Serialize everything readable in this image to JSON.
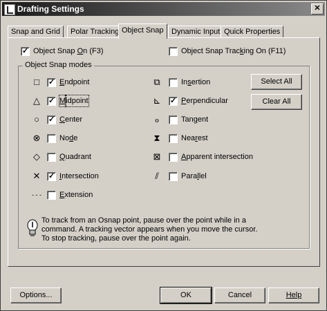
{
  "window": {
    "title": "Drafting Settings",
    "close_glyph": "✕"
  },
  "tabs": [
    {
      "label": "Snap and Grid"
    },
    {
      "label": "Polar Tracking"
    },
    {
      "label": "Object Snap",
      "active": true
    },
    {
      "label": "Dynamic Input"
    },
    {
      "label": "Quick Properties"
    }
  ],
  "top_options": {
    "snap_on": {
      "label_pre": "Object Snap ",
      "label_u": "O",
      "label_post": "n (F3)",
      "checked": true
    },
    "tracking_on": {
      "label_pre": "Object Snap Trac",
      "label_u": "k",
      "label_post": "ing On (F11)",
      "checked": false
    }
  },
  "group": {
    "legend": "Object Snap modes"
  },
  "modes_left": [
    {
      "name": "Endpoint",
      "u": "E",
      "rest": "ndpoint",
      "checked": true,
      "icon": "□"
    },
    {
      "name": "Midpoint",
      "u": "M",
      "rest": "idpoint",
      "checked": true,
      "icon": "△"
    },
    {
      "name": "Center",
      "u": "C",
      "rest": "enter",
      "checked": true,
      "icon": "○"
    },
    {
      "name": "Node",
      "pre": "No",
      "u": "d",
      "rest": "e",
      "checked": false,
      "icon": "⊗"
    },
    {
      "name": "Quadrant",
      "u": "Q",
      "rest": "uadrant",
      "checked": false,
      "icon": "◇"
    },
    {
      "name": "Intersection",
      "u": "I",
      "rest": "ntersection",
      "checked": true,
      "icon": "✕"
    },
    {
      "name": "Extension",
      "u": "E",
      "rest": "xtension",
      "checked": false,
      "icon": "- - -"
    }
  ],
  "modes_right": [
    {
      "name": "Insertion",
      "pre": "In",
      "u": "s",
      "rest": "ertion",
      "checked": false,
      "icon": "⧉"
    },
    {
      "name": "Perpendicular",
      "u": "P",
      "rest": "erpendicular",
      "checked": true,
      "icon": "⊾"
    },
    {
      "name": "Tangent",
      "pre": "Tan",
      "u": "g",
      "rest": "ent",
      "checked": false,
      "icon": "ℴ"
    },
    {
      "name": "Nearest",
      "pre": "Nea",
      "u": "r",
      "rest": "est",
      "checked": false,
      "icon": "⧗"
    },
    {
      "name": "Apparent intersection",
      "u": "A",
      "rest": "pparent intersection",
      "checked": false,
      "icon": "⊠"
    },
    {
      "name": "Parallel",
      "pre": "Para",
      "u": "l",
      "rest": "lel",
      "checked": false,
      "icon": "⫽"
    }
  ],
  "buttons": {
    "select_all": "Select All",
    "clear_all": "Clear All"
  },
  "hint": {
    "line1": "To track from an Osnap point, pause over the point while in a",
    "line2": "command.  A tracking vector appears when you move the cursor.",
    "line3": "To stop tracking, pause over the point again."
  },
  "footer": {
    "options": "Options...",
    "ok": "OK",
    "cancel": "Cancel",
    "help": "Help"
  }
}
